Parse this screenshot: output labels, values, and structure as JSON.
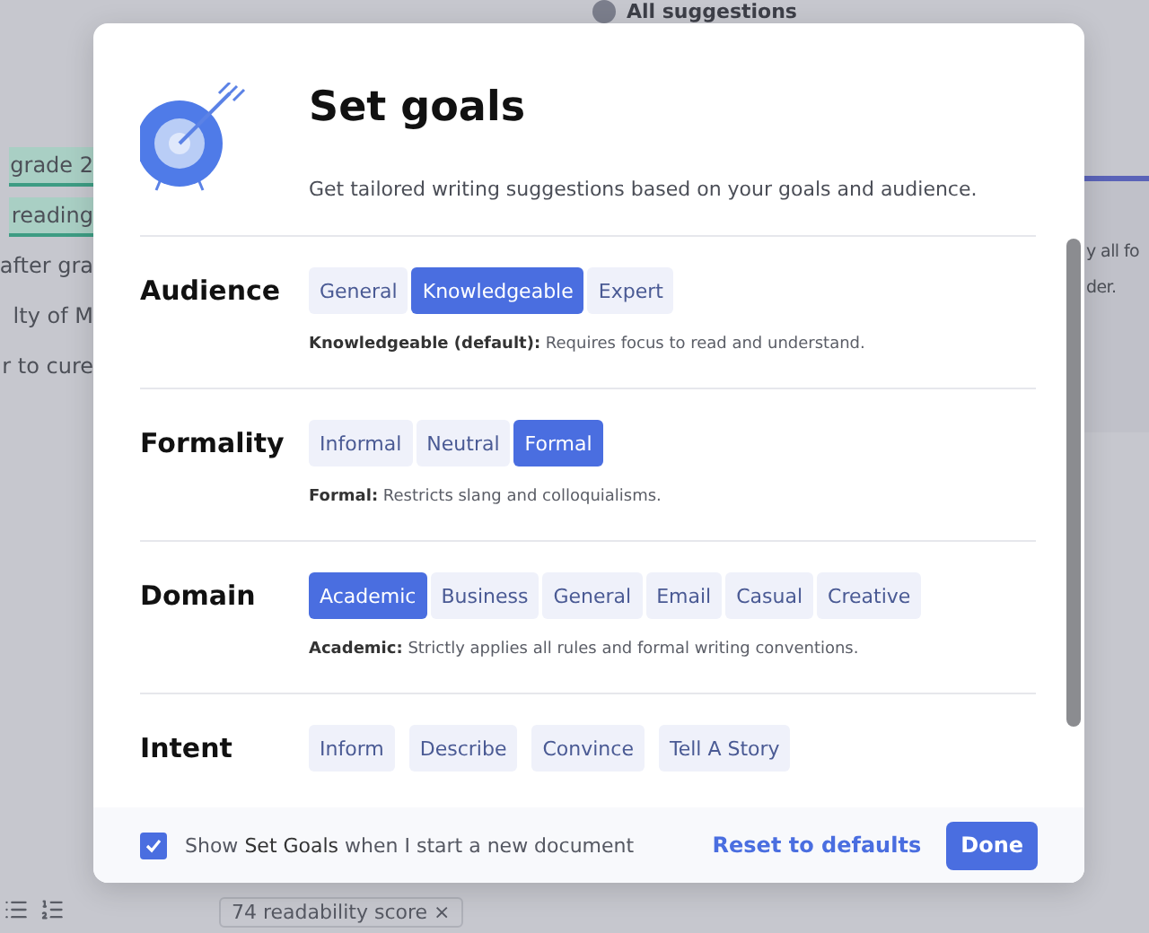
{
  "backdrop": {
    "top_heading": "All suggestions",
    "left_lines": [
      {
        "text": "grade 2",
        "highlighted": true
      },
      {
        "text": "reading",
        "highlighted": true
      },
      {
        "text": "after gra",
        "highlighted": false
      },
      {
        "text": "lty of M",
        "highlighted": false
      },
      {
        "text": "r to cure",
        "highlighted": false
      }
    ],
    "right_lines": [
      "y all fo",
      "der."
    ],
    "score_tag": "74 readability score ×"
  },
  "dialog": {
    "title": "Set goals",
    "subtitle": "Get tailored writing suggestions based on your goals and audience.",
    "sections": [
      {
        "label": "Audience",
        "kind": "segmented",
        "options": [
          {
            "label": "General",
            "selected": false
          },
          {
            "label": "Knowledgeable",
            "selected": true
          },
          {
            "label": "Expert",
            "selected": false
          }
        ],
        "description": "**Knowledgeable (default):** Requires focus to read and understand."
      },
      {
        "label": "Formality",
        "kind": "segmented",
        "options": [
          {
            "label": "Informal",
            "selected": false
          },
          {
            "label": "Neutral",
            "selected": false
          },
          {
            "label": "Formal",
            "selected": true
          }
        ],
        "description": "**Formal:** Restricts slang and colloquialisms."
      },
      {
        "label": "Domain",
        "kind": "segmented",
        "options": [
          {
            "label": "Academic",
            "selected": true
          },
          {
            "label": "Business",
            "selected": false
          },
          {
            "label": "General",
            "selected": false
          },
          {
            "label": "Email",
            "selected": false
          },
          {
            "label": "Casual",
            "selected": false
          },
          {
            "label": "Creative",
            "selected": false
          }
        ],
        "description": "**Academic:** Strictly applies all rules and formal writing conventions."
      },
      {
        "label": "Intent",
        "kind": "multi",
        "options": [
          {
            "label": "Inform",
            "selected": false
          },
          {
            "label": "Describe",
            "selected": false
          },
          {
            "label": "Convince",
            "selected": false
          },
          {
            "label": "Tell A Story",
            "selected": false
          }
        ]
      }
    ],
    "footer": {
      "show_on_start": {
        "label": "Show **Set Goals** when I start a new document",
        "checked": true
      },
      "reset_link": "Reset to defaults",
      "done_button": "Done"
    }
  }
}
